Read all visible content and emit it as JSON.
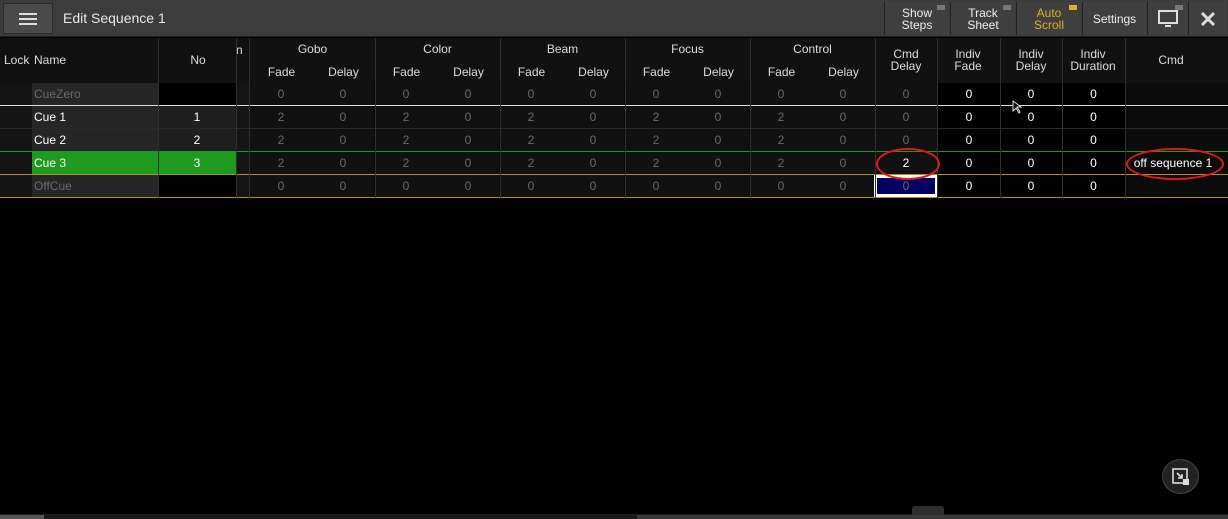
{
  "window": {
    "title": "Edit Sequence 1",
    "buttons": [
      {
        "label": "Show\nSteps"
      },
      {
        "label": "Track\nSheet"
      },
      {
        "label": "Auto\nScroll"
      },
      {
        "label": "Settings"
      }
    ]
  },
  "table": {
    "headers": {
      "lock": "Lock",
      "name": "Name",
      "no": "No",
      "cut": "n",
      "groups": [
        "Gobo",
        "Color",
        "Beam",
        "Focus",
        "Control"
      ],
      "fade": "Fade",
      "delay": "Delay",
      "cmd_delay": "Cmd\nDelay",
      "indiv_fade": "Indiv\nFade",
      "indiv_delay": "Indiv\nDelay",
      "indiv_duration": "Indiv\nDuration",
      "cmd": "Cmd"
    },
    "rows": [
      {
        "name": "CueZero",
        "no": "",
        "vals": [
          "0",
          "0",
          "0",
          "0",
          "0",
          "0",
          "0",
          "0",
          "0",
          "0"
        ],
        "cmd_delay": "0",
        "indiv_fade": "0",
        "indiv_delay": "0",
        "indiv_duration": "0",
        "cmd": ""
      },
      {
        "name": "Cue 1",
        "no": "1",
        "vals": [
          "2",
          "0",
          "2",
          "0",
          "2",
          "0",
          "2",
          "0",
          "2",
          "0"
        ],
        "cmd_delay": "0",
        "indiv_fade": "0",
        "indiv_delay": "0",
        "indiv_duration": "0",
        "cmd": ""
      },
      {
        "name": "Cue 2",
        "no": "2",
        "vals": [
          "2",
          "0",
          "2",
          "0",
          "2",
          "0",
          "2",
          "0",
          "2",
          "0"
        ],
        "cmd_delay": "0",
        "indiv_fade": "0",
        "indiv_delay": "0",
        "indiv_duration": "0",
        "cmd": ""
      },
      {
        "name": "Cue 3",
        "no": "3",
        "vals": [
          "2",
          "0",
          "2",
          "0",
          "2",
          "0",
          "2",
          "0",
          "2",
          "0"
        ],
        "cmd_delay": "2",
        "indiv_fade": "0",
        "indiv_delay": "0",
        "indiv_duration": "0",
        "cmd": "off sequence 1"
      },
      {
        "name": "OffCue",
        "no": "",
        "vals": [
          "0",
          "0",
          "0",
          "0",
          "0",
          "0",
          "0",
          "0",
          "0",
          "0"
        ],
        "cmd_delay": "0",
        "indiv_fade": "0",
        "indiv_delay": "0",
        "indiv_duration": "0",
        "cmd": ""
      }
    ]
  },
  "colors": {
    "active_cue": "#1e9a1e",
    "selected_cell": "#000060",
    "annotation": "#e01818",
    "autoscroll": "#e0b020"
  },
  "icons": [
    "menu-icon",
    "monitor-icon",
    "close-icon",
    "expand-icon"
  ]
}
